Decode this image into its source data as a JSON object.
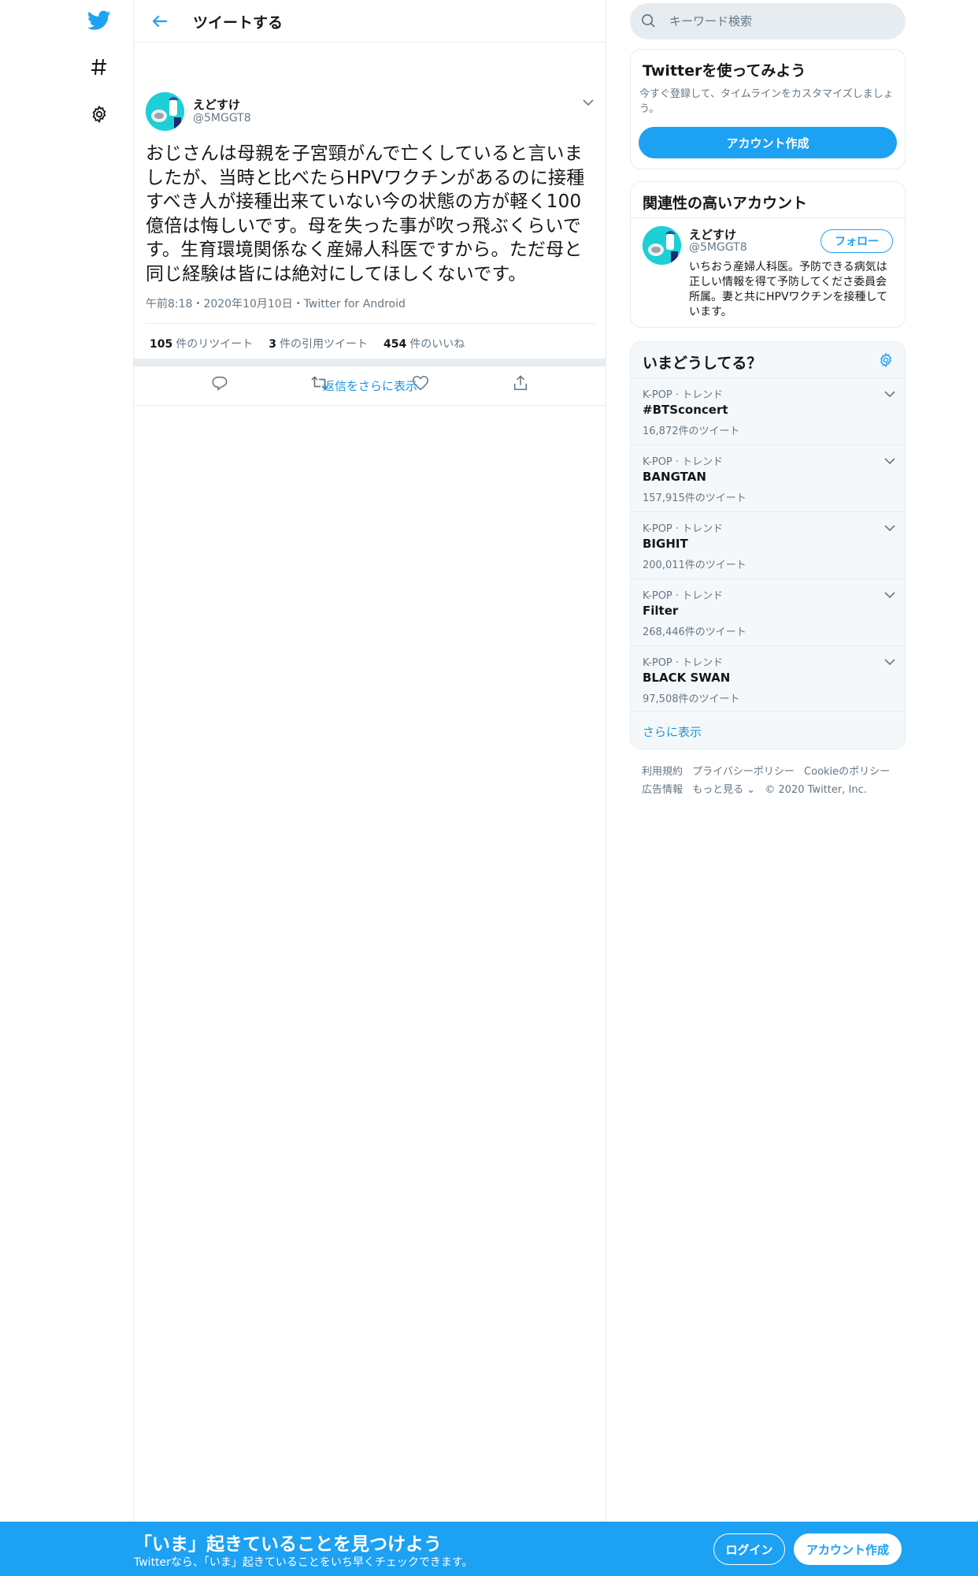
{
  "colors": {
    "brand": "#1da1f2",
    "link": "#1b95e0",
    "muted": "#657786",
    "divider": "#e6ecf0"
  },
  "nav": {
    "icons": [
      "twitter-logo-icon",
      "hashtag-icon",
      "gear-icon"
    ]
  },
  "header": {
    "title": "ツイートする"
  },
  "tweet": {
    "author_name": "えどすけ",
    "author_handle": "@5MGGT8",
    "text": "おじさんは母親を子宮頸がんで亡くしていると言いましたが、当時と比べたらHPVワクチンがあるのに接種すべき人が接種出来ていない今の状態の方が軽く100億倍は悔しいです。母を失った事が吹っ飛ぶくらいです。生育環境関係なく産婦人科医ですから。ただ母と同じ経験は皆には絶対にしてほしくないです。",
    "meta": "午前8:18・2020年10月10日・Twitter for Android",
    "stats": [
      {
        "count": "105",
        "label": "件のリツイート"
      },
      {
        "count": "3",
        "label": "件の引用ツイート"
      },
      {
        "count": "454",
        "label": "件のいいね"
      }
    ],
    "more_replies": "返信をさらに表示"
  },
  "search": {
    "placeholder": "キーワード検索"
  },
  "signup_card": {
    "title": "Twitterを使ってみよう",
    "desc": "今すぐ登録して、タイムラインをカスタマイズしましょう。",
    "button": "アカウント作成"
  },
  "related": {
    "title": "関連性の高いアカウント",
    "name": "えどすけ",
    "handle": "@5MGGT8",
    "follow": "フォロー",
    "bio": "いちおう産婦人科医。予防できる病気は正しい情報を得て予防してくださ委員会所属。妻と共にHPVワクチンを接種しています。"
  },
  "trends": {
    "title": "いまどうしてる？",
    "items": [
      {
        "category": "K-POP · トレンド",
        "name": "#BTSconcert",
        "count": "16,872件のツイート"
      },
      {
        "category": "K-POP · トレンド",
        "name": "BANGTAN",
        "count": "157,915件のツイート"
      },
      {
        "category": "K-POP · トレンド",
        "name": "BIGHIT",
        "count": "200,011件のツイート"
      },
      {
        "category": "K-POP · トレンド",
        "name": "Filter",
        "count": "268,446件のツイート"
      },
      {
        "category": "K-POP · トレンド",
        "name": "BLACK SWAN",
        "count": "97,508件のツイート"
      }
    ],
    "show_more": "さらに表示"
  },
  "footer": {
    "links": [
      "利用規約",
      "プライバシーポリシー",
      "Cookieのポリシー",
      "広告情報",
      "もっと見る ⌄"
    ],
    "copyright": "© 2020 Twitter, Inc."
  },
  "bottom_bar": {
    "title": "「いま」起きていることを見つけよう",
    "subtitle": "Twitterなら、「いま」起きていることをいち早くチェックできます。",
    "login": "ログイン",
    "signup": "アカウント作成"
  }
}
